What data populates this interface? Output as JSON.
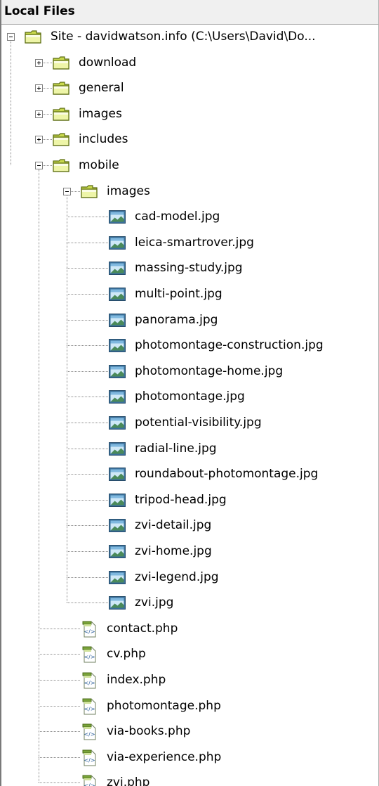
{
  "header": {
    "title": "Local Files"
  },
  "tree": [
    {
      "label": "Site - davidwatson.info (C:\\Users\\David\\Do...",
      "icon": "folder-icon",
      "depth": 0,
      "toggle": "minus"
    },
    {
      "label": "download",
      "icon": "folder-icon",
      "depth": 1,
      "toggle": "plus"
    },
    {
      "label": "general",
      "icon": "folder-icon",
      "depth": 1,
      "toggle": "plus"
    },
    {
      "label": "images",
      "icon": "folder-icon",
      "depth": 1,
      "toggle": "plus"
    },
    {
      "label": "includes",
      "icon": "folder-icon",
      "depth": 1,
      "toggle": "plus"
    },
    {
      "label": "mobile",
      "icon": "folder-icon",
      "depth": 1,
      "toggle": "minus"
    },
    {
      "label": "images",
      "icon": "folder-icon",
      "depth": 2,
      "toggle": "minus"
    },
    {
      "label": "cad-model.jpg",
      "icon": "image-file-icon",
      "depth": 3
    },
    {
      "label": "leica-smartrover.jpg",
      "icon": "image-file-icon",
      "depth": 3
    },
    {
      "label": "massing-study.jpg",
      "icon": "image-file-icon",
      "depth": 3
    },
    {
      "label": "multi-point.jpg",
      "icon": "image-file-icon",
      "depth": 3
    },
    {
      "label": "panorama.jpg",
      "icon": "image-file-icon",
      "depth": 3
    },
    {
      "label": "photomontage-construction.jpg",
      "icon": "image-file-icon",
      "depth": 3
    },
    {
      "label": "photomontage-home.jpg",
      "icon": "image-file-icon",
      "depth": 3
    },
    {
      "label": "photomontage.jpg",
      "icon": "image-file-icon",
      "depth": 3
    },
    {
      "label": "potential-visibility.jpg",
      "icon": "image-file-icon",
      "depth": 3
    },
    {
      "label": "radial-line.jpg",
      "icon": "image-file-icon",
      "depth": 3
    },
    {
      "label": "roundabout-photomontage.jpg",
      "icon": "image-file-icon",
      "depth": 3
    },
    {
      "label": "tripod-head.jpg",
      "icon": "image-file-icon",
      "depth": 3
    },
    {
      "label": "zvi-detail.jpg",
      "icon": "image-file-icon",
      "depth": 3
    },
    {
      "label": "zvi-home.jpg",
      "icon": "image-file-icon",
      "depth": 3
    },
    {
      "label": "zvi-legend.jpg",
      "icon": "image-file-icon",
      "depth": 3
    },
    {
      "label": "zvi.jpg",
      "icon": "image-file-icon",
      "depth": 3
    },
    {
      "label": "contact.php",
      "icon": "php-file-icon",
      "depth": 2
    },
    {
      "label": "cv.php",
      "icon": "php-file-icon",
      "depth": 2
    },
    {
      "label": "index.php",
      "icon": "php-file-icon",
      "depth": 2
    },
    {
      "label": "photomontage.php",
      "icon": "php-file-icon",
      "depth": 2
    },
    {
      "label": "via-books.php",
      "icon": "php-file-icon",
      "depth": 2
    },
    {
      "label": "via-experience.php",
      "icon": "php-file-icon",
      "depth": 2
    },
    {
      "label": "zvi.php",
      "icon": "php-file-icon",
      "depth": 2
    }
  ]
}
